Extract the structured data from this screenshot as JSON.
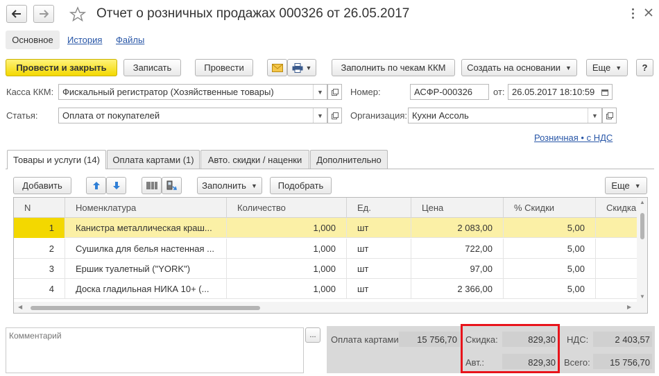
{
  "title": "Отчет о розничных продажах 000326 от 26.05.2017",
  "nav": {
    "back_icon": "arrow-left",
    "forward_icon": "arrow-right",
    "star_icon": "star",
    "more_icon": "vertical-dots",
    "close_icon": "cross"
  },
  "subtabs": [
    "Основное",
    "История",
    "Файлы"
  ],
  "toolbar": {
    "post_close": "Провести и закрыть",
    "write": "Записать",
    "post": "Провести",
    "fill_by_checks": "Заполнить по чекам ККМ",
    "create_based": "Создать на основании",
    "more": "Еще",
    "help": "?"
  },
  "form": {
    "kassa_label": "Касса ККМ:",
    "kassa_value": "Фискальный регистратор (Хозяйственные товары)",
    "article_label": "Статья:",
    "article_value": "Оплата от покупателей",
    "number_label": "Номер:",
    "number_value": "АСФР-000326",
    "date_label": "от:",
    "date_value": "26.05.2017 18:10:59",
    "org_label": "Организация:",
    "org_value": "Кухни Ассоль",
    "price_link": "Розничная • с НДС"
  },
  "tabs": [
    "Товары и услуги (14)",
    "Оплата картами (1)",
    "Авто. скидки / наценки",
    "Дополнительно"
  ],
  "table_toolbar": {
    "add": "Добавить",
    "fill": "Заполнить",
    "pick": "Подобрать",
    "more": "Еще"
  },
  "table": {
    "columns": [
      "N",
      "Номенклатура",
      "Количество",
      "Ед.",
      "Цена",
      "% Скидки",
      "Скидка"
    ],
    "rows": [
      [
        "1",
        "Канистра металлическая краш...",
        "1,000",
        "шт",
        "2 083,00",
        "5,00"
      ],
      [
        "2",
        "Сушилка для белья настенная ...",
        "1,000",
        "шт",
        "722,00",
        "5,00"
      ],
      [
        "3",
        "Ершик туалетный (\"YORK\")",
        "1,000",
        "шт",
        "97,00",
        "5,00"
      ],
      [
        "4",
        "Доска гладильная  НИКА 10+ (...",
        "1,000",
        "шт",
        "2 366,00",
        "5,00"
      ]
    ]
  },
  "comment": {
    "placeholder": "Комментарий",
    "button": "..."
  },
  "totals": {
    "cards_label": "Оплата картами:",
    "cards_value": "15 756,70",
    "discount_label": "Скидка:",
    "discount_value": "829,30",
    "auto_label": "Авт.:",
    "auto_value": "829,30",
    "vat_label": "НДС:",
    "vat_value": "2 403,57",
    "total_label": "Всего:",
    "total_value": "15 756,70"
  },
  "colors": {
    "primary": "#f3d800",
    "selected_row": "#fbf0a6",
    "highlight": "#e8141b",
    "link": "#2856a7"
  }
}
